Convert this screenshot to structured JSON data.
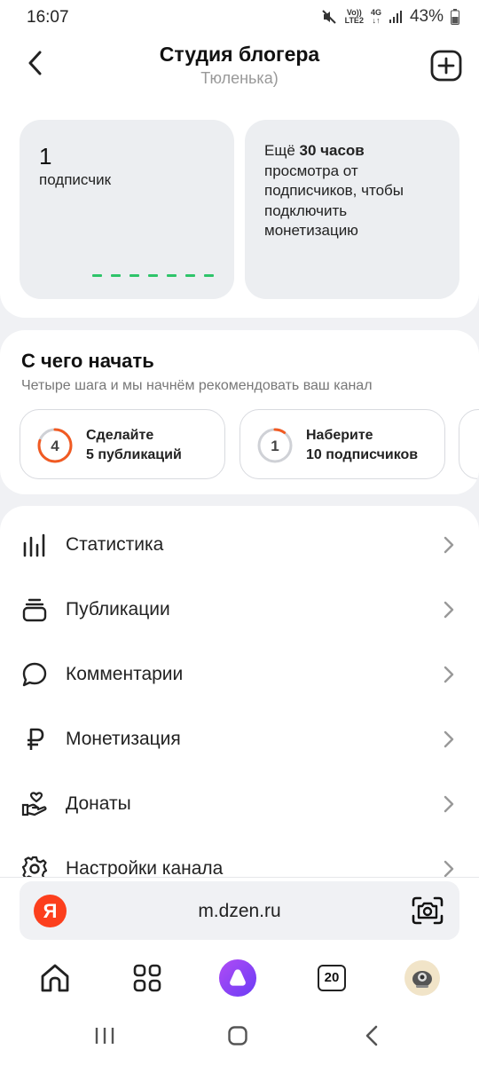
{
  "status_bar": {
    "time": "16:07",
    "volte": "Vo))",
    "lte": "LTE2",
    "net": "4G",
    "battery": "43%"
  },
  "header": {
    "title": "Студия блогера",
    "subtitle": "Тюленька)"
  },
  "stats": {
    "subscriber_count": "1",
    "subscriber_label": "подписчик",
    "monetization_prefix": "Ещё ",
    "monetization_hours": "30 часов",
    "monetization_rest": "просмотра от подписчиков, чтобы подключить монетизацию"
  },
  "getting_started": {
    "title": "С чего начать",
    "subtitle": "Четыре шага и мы начнём рекомендовать ваш канал",
    "steps": [
      {
        "number": "4",
        "line1": "Сделайте",
        "line2": "5 публикаций",
        "progress": 0.8
      },
      {
        "number": "1",
        "line1": "Наберите",
        "line2": "10 подписчиков",
        "progress": 0.1
      }
    ]
  },
  "menu": {
    "items": [
      {
        "label": "Статистика",
        "icon": "stats-icon"
      },
      {
        "label": "Публикации",
        "icon": "publications-icon"
      },
      {
        "label": "Комментарии",
        "icon": "comment-icon"
      },
      {
        "label": "Монетизация",
        "icon": "ruble-icon"
      },
      {
        "label": "Донаты",
        "icon": "donation-icon"
      },
      {
        "label": "Настройки канала",
        "icon": "gear-icon"
      }
    ]
  },
  "url_bar": {
    "logo": "Я",
    "url": "m.dzen.ru"
  },
  "bottom_nav": {
    "tabs_count": "20"
  },
  "colors": {
    "accent_orange": "#f15a22",
    "progress_green": "#2ec46a",
    "alice_purple": "#8a3ffc",
    "yandex_red": "#fc3f1d"
  }
}
